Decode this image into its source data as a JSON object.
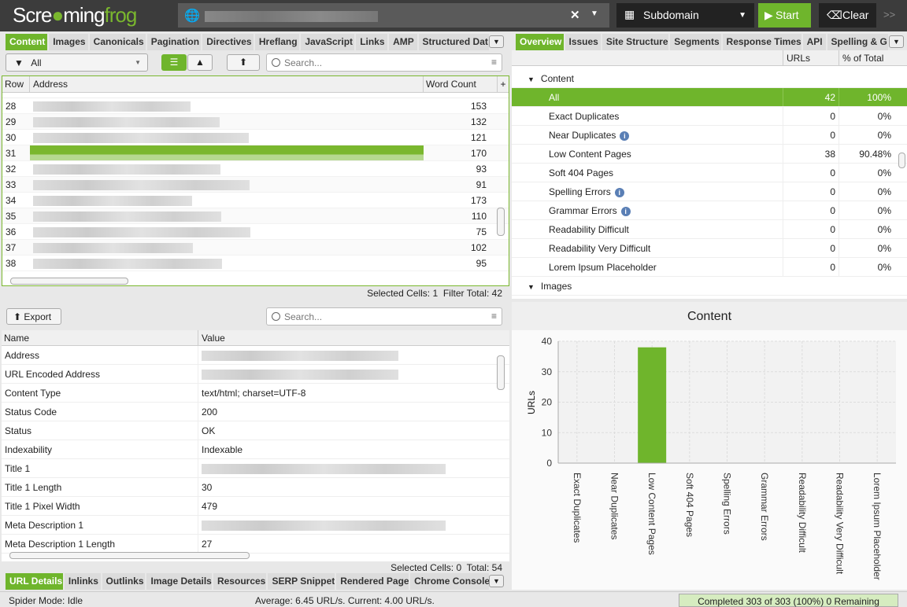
{
  "app": {
    "logo": "Screamingfrog",
    "mode": "Subdomain",
    "start": "Start",
    "clear": "Clear",
    "more": ">>"
  },
  "left_tabs": [
    "Content",
    "Images",
    "Canonicals",
    "Pagination",
    "Directives",
    "Hreflang",
    "JavaScript",
    "Links",
    "AMP",
    "Structured Dat"
  ],
  "filter": {
    "value": "All",
    "search_placeholder": "Search..."
  },
  "main_table": {
    "columns": [
      "Row",
      "Address",
      "Word Count"
    ],
    "rows": [
      [
        "28",
        "153"
      ],
      [
        "29",
        "132"
      ],
      [
        "30",
        "121"
      ],
      [
        "31",
        "170"
      ],
      [
        "32",
        "93"
      ],
      [
        "33",
        "91"
      ],
      [
        "34",
        "173"
      ],
      [
        "35",
        "110"
      ],
      [
        "36",
        "75"
      ],
      [
        "37",
        "102"
      ],
      [
        "38",
        "95"
      ]
    ],
    "selected_row": "31",
    "status_selected_label": "Selected Cells:",
    "status_selected": "1",
    "status_total_label": "Filter Total:",
    "status_total": "42"
  },
  "details": {
    "export": "Export",
    "search_placeholder": "Search...",
    "columns": [
      "Name",
      "Value"
    ],
    "rows": [
      [
        "Address",
        ""
      ],
      [
        "URL Encoded Address",
        ""
      ],
      [
        "Content Type",
        "text/html; charset=UTF-8"
      ],
      [
        "Status Code",
        "200"
      ],
      [
        "Status",
        "OK"
      ],
      [
        "Indexability",
        "Indexable"
      ],
      [
        "Title 1",
        ""
      ],
      [
        "Title 1 Length",
        "30"
      ],
      [
        "Title 1 Pixel Width",
        "479"
      ],
      [
        "Meta Description 1",
        ""
      ],
      [
        "Meta Description 1 Length",
        "27"
      ]
    ],
    "status_selected_label": "Selected Cells:",
    "status_selected": "0",
    "status_total_label": "Total:",
    "status_total": "54"
  },
  "bottom_tabs": [
    "URL Details",
    "Inlinks",
    "Outlinks",
    "Image Details",
    "Resources",
    "SERP Snippet",
    "Rendered Page",
    "Chrome Console"
  ],
  "right_tabs": [
    "Overview",
    "Issues",
    "Site Structure",
    "Segments",
    "Response Times",
    "API",
    "Spelling & G"
  ],
  "overview": {
    "columns": [
      "",
      "URLs",
      "% of Total"
    ],
    "section": "Content",
    "section2": "Images",
    "rows": [
      {
        "label": "All",
        "urls": "42",
        "pct": "100%",
        "selected": true
      },
      {
        "label": "Exact Duplicates",
        "urls": "0",
        "pct": "0%"
      },
      {
        "label": "Near Duplicates",
        "urls": "0",
        "pct": "0%",
        "info": true
      },
      {
        "label": "Low Content Pages",
        "urls": "38",
        "pct": "90.48%"
      },
      {
        "label": "Soft 404 Pages",
        "urls": "0",
        "pct": "0%"
      },
      {
        "label": "Spelling Errors",
        "urls": "0",
        "pct": "0%",
        "info": true
      },
      {
        "label": "Grammar Errors",
        "urls": "0",
        "pct": "0%",
        "info": true
      },
      {
        "label": "Readability Difficult",
        "urls": "0",
        "pct": "0%"
      },
      {
        "label": "Readability Very Difficult",
        "urls": "0",
        "pct": "0%"
      },
      {
        "label": "Lorem Ipsum Placeholder",
        "urls": "0",
        "pct": "0%"
      }
    ]
  },
  "chart_data": {
    "type": "bar",
    "title": "Content",
    "ylabel": "URLs",
    "xlabel": "",
    "ylim": [
      0,
      40
    ],
    "yticks": [
      0,
      10,
      20,
      30,
      40
    ],
    "grid": true,
    "color": "#6fb52c",
    "categories": [
      "Exact Duplicates",
      "Near Duplicates",
      "Low Content Pages",
      "Soft 404 Pages",
      "Spelling Errors",
      "Grammar Errors",
      "Readability Difficult",
      "Readability Very Difficult",
      "Lorem Ipsum Placeholder"
    ],
    "values": [
      0,
      0,
      38,
      0,
      0,
      0,
      0,
      0,
      0
    ]
  },
  "statusbar": {
    "mode": "Spider Mode: Idle",
    "speed": "Average: 6.45 URL/s. Current: 4.00 URL/s.",
    "progress_text": "Completed 303 of 303 (100%) 0 Remaining",
    "progress": 100
  },
  "colors": {
    "accent": "#6fb52c",
    "topbar": "#3c3c3c"
  }
}
